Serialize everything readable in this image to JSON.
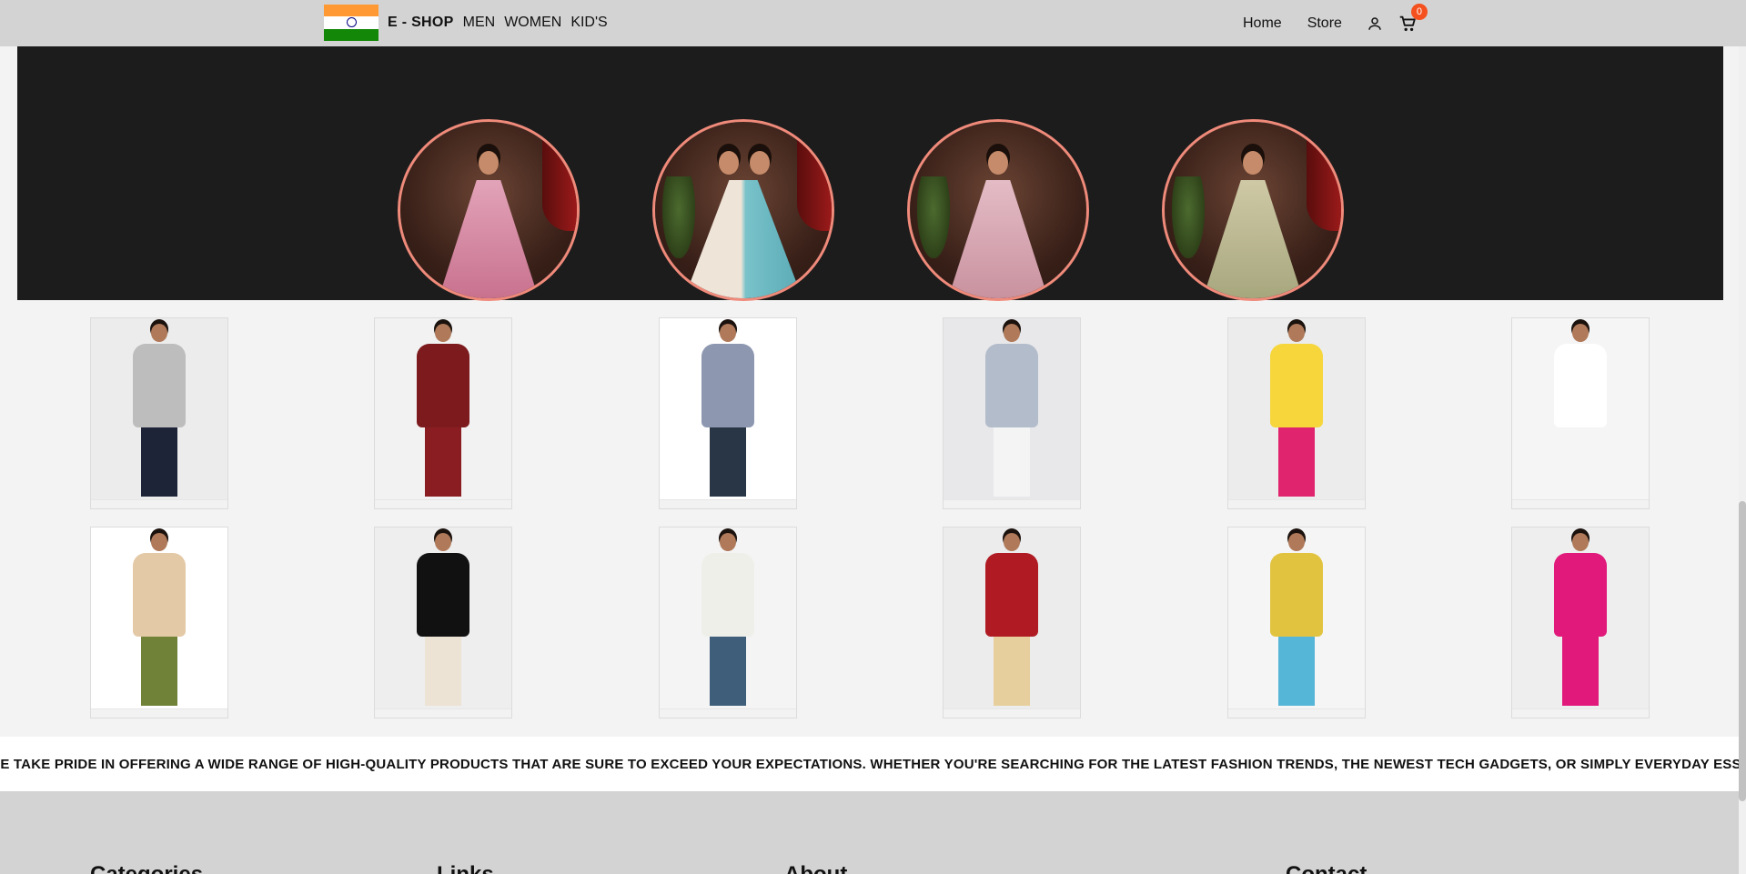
{
  "navbar": {
    "brand": "E - SHOP",
    "left_links": [
      "MEN",
      "WOMEN",
      "KID'S"
    ],
    "right_links": [
      "Home",
      "Store"
    ],
    "cart_count": "0",
    "icons": [
      "user-icon",
      "cart-icon"
    ]
  },
  "hero": {
    "circles": [
      {
        "name": "pink lehenga",
        "gown": "#d98aa6"
      },
      {
        "name": "two women sarees",
        "gown": "#7fc3cc"
      },
      {
        "name": "pink anarkali",
        "gown": "#d7a9b6"
      },
      {
        "name": "gold gown",
        "gown": "#c2c29a"
      }
    ]
  },
  "products": [
    {
      "name": "grey striped kurti",
      "bg": "#ececec",
      "top": "#bdbdbd",
      "bottom": "#1e2437"
    },
    {
      "name": "maroon anarkali dress",
      "bg": "#f2f2f2",
      "top": "#7d1a1d",
      "bottom": "#8a1d22"
    },
    {
      "name": "blue mens shirt",
      "bg": "#ffffff",
      "top": "#8d97b0",
      "bottom": "#293646"
    },
    {
      "name": "grey mens kurta",
      "bg": "#e8e8ea",
      "top": "#b3bccb",
      "bottom": "#f4f4f4"
    },
    {
      "name": "kids yellow kurta set",
      "bg": "#ececec",
      "top": "#f6d63a",
      "bottom": "#e0246d"
    },
    {
      "name": "kids white shirt",
      "bg": "#f5f5f5",
      "top": "#ffffff",
      "bottom": "#f5f5f5"
    },
    {
      "name": "printed long skirt",
      "bg": "#ffffff",
      "top": "#e4c9a6",
      "bottom": "#6f8237"
    },
    {
      "name": "black crop top",
      "bg": "#eeeeee",
      "top": "#111111",
      "bottom": "#ede3d5"
    },
    {
      "name": "white mens kurta",
      "bg": "#f4f4f4",
      "top": "#efefea",
      "bottom": "#3f5e7a"
    },
    {
      "name": "red mens kurta",
      "bg": "#ececec",
      "top": "#b01a22",
      "bottom": "#e6cf9c"
    },
    {
      "name": "kids lehenga",
      "bg": "#f5f5f5",
      "top": "#e2c340",
      "bottom": "#56b6d8"
    },
    {
      "name": "kids pink dress",
      "bg": "#eeeeee",
      "top": "#e0197a",
      "bottom": "#e0197a"
    }
  ],
  "marquee": {
    "text": "WE TAKE PRIDE IN OFFERING A WIDE RANGE OF HIGH-QUALITY PRODUCTS THAT ARE SURE TO EXCEED YOUR EXPECTATIONS. WHETHER YOU'RE SEARCHING FOR THE LATEST FASHION TRENDS, THE NEWEST TECH GADGETS, OR SIMPLY EVERYDAY ESSENTIALS"
  },
  "footer": {
    "headings": [
      "Categories",
      "Links",
      "About",
      "Contact"
    ]
  }
}
